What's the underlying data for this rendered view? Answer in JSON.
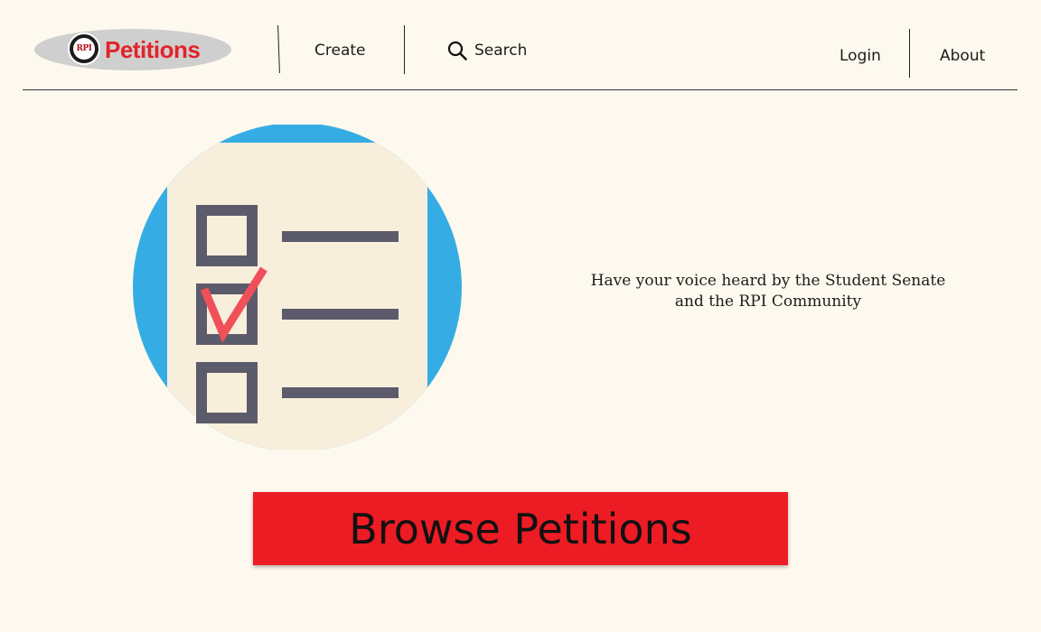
{
  "header": {
    "logo": {
      "badge_text": "RPI",
      "brand_text": "Petitions"
    },
    "nav": {
      "create": "Create",
      "search": "Search",
      "login": "Login",
      "about": "About"
    }
  },
  "hero": {
    "illustration_icon": "checklist-icon",
    "tagline_line1": "Have your voice heard by the Student Senate",
    "tagline_line2": "and the RPI Community"
  },
  "cta": {
    "browse_label": "Browse Petitions"
  },
  "colors": {
    "background": "#fdf9ee",
    "brand_red": "#ed1c24",
    "illustration_blue": "#35ade4",
    "paper": "#f7eedb",
    "checkbox_gray": "#5c5b6b",
    "check_red": "#f0505a"
  }
}
